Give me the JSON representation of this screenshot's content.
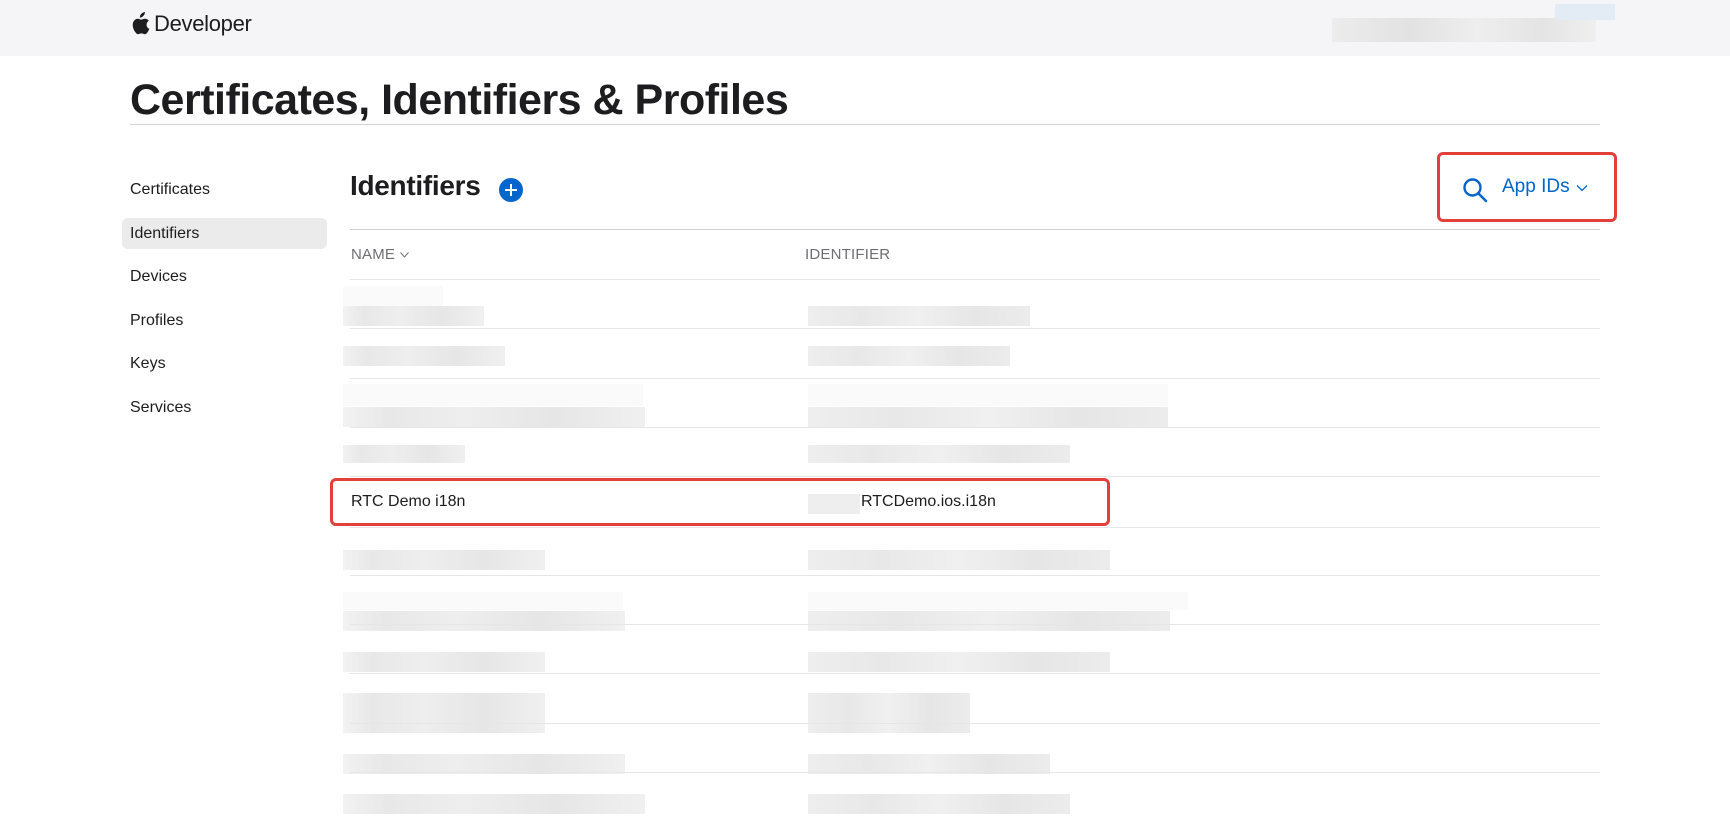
{
  "header": {
    "brand": "Developer",
    "icons": {
      "logo": "apple-logo-icon"
    }
  },
  "page": {
    "title": "Certificates, Identifiers & Profiles"
  },
  "sidebar": {
    "items": [
      {
        "label": "Certificates",
        "active": false
      },
      {
        "label": "Identifiers",
        "active": true
      },
      {
        "label": "Devices",
        "active": false
      },
      {
        "label": "Profiles",
        "active": false
      },
      {
        "label": "Keys",
        "active": false
      },
      {
        "label": "Services",
        "active": false
      }
    ]
  },
  "section": {
    "title": "Identifiers",
    "add_icon": "plus-circle-icon"
  },
  "filter": {
    "search_icon": "search-icon",
    "label": "App IDs",
    "chevron_icon": "chevron-down-icon"
  },
  "table": {
    "columns": {
      "name": "NAME",
      "identifier": "IDENTIFIER"
    },
    "highlighted_row": {
      "name": "RTC Demo i18n",
      "identifier": "RTCDemo.ios.i18n"
    }
  },
  "colors": {
    "accent": "#0066cc",
    "highlight_border": "#e3403c",
    "header_bg": "#f5f5f7",
    "active_item_bg": "#ebebeb"
  }
}
